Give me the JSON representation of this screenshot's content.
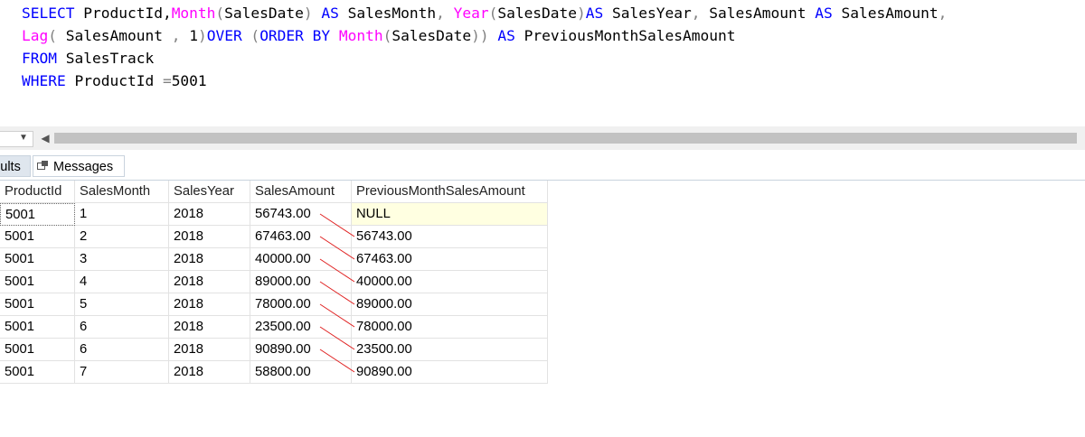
{
  "editor": {
    "line1": {
      "t1": "SELECT",
      "t2": " ProductId,",
      "t3": "Month",
      "t4": "(",
      "t5": "SalesDate",
      "t6": ")",
      "t7": " AS",
      "t8": " SalesMonth",
      "t9": ",",
      "t10": " Year",
      "t11": "(",
      "t12": "SalesDate",
      "t13": ")",
      "t14": "AS",
      "t15": " SalesYear",
      "t16": ",",
      "t17": " SalesAmount ",
      "t18": "AS",
      "t19": " SalesAmount",
      "t20": ","
    },
    "line2": {
      "t1": "Lag",
      "t2": "(",
      "t3": " SalesAmount ",
      "t4": ",",
      "t5": " 1",
      "t6": ")",
      "t7": "OVER",
      "t8": " (",
      "t9": "ORDER BY",
      "t10": " Month",
      "t11": "(",
      "t12": "SalesDate",
      "t13": "))",
      "t14": " AS",
      "t15": " PreviousMonthSalesAmount"
    },
    "line3": {
      "t1": "FROM",
      "t2": " SalesTrack"
    },
    "line4": {
      "t1": "WHERE",
      "t2": " ProductId ",
      "t3": "=",
      "t4": "5001"
    }
  },
  "scrollbar": {
    "left_arrow": "◀",
    "dropdown_caret": "▼"
  },
  "tabs": {
    "results_label": "sults",
    "messages_label": "Messages"
  },
  "grid": {
    "columns": [
      "ProductId",
      "SalesMonth",
      "SalesYear",
      "SalesAmount",
      "PreviousMonthSalesAmount"
    ],
    "rows": [
      [
        "5001",
        "1",
        "2018",
        "56743.00",
        "NULL"
      ],
      [
        "5001",
        "2",
        "2018",
        "67463.00",
        "56743.00"
      ],
      [
        "5001",
        "3",
        "2018",
        "40000.00",
        "67463.00"
      ],
      [
        "5001",
        "4",
        "2018",
        "89000.00",
        "40000.00"
      ],
      [
        "5001",
        "5",
        "2018",
        "78000.00",
        "89000.00"
      ],
      [
        "5001",
        "6",
        "2018",
        "23500.00",
        "78000.00"
      ],
      [
        "5001",
        "6",
        "2018",
        "90890.00",
        "23500.00"
      ],
      [
        "5001",
        "7",
        "2018",
        "58800.00",
        "90890.00"
      ]
    ]
  },
  "colors": {
    "keyword": "#0000ff",
    "function": "#ff00ff",
    "operator": "#808080",
    "annotation_line": "#e02020",
    "null_highlight": "#ffffe1"
  }
}
